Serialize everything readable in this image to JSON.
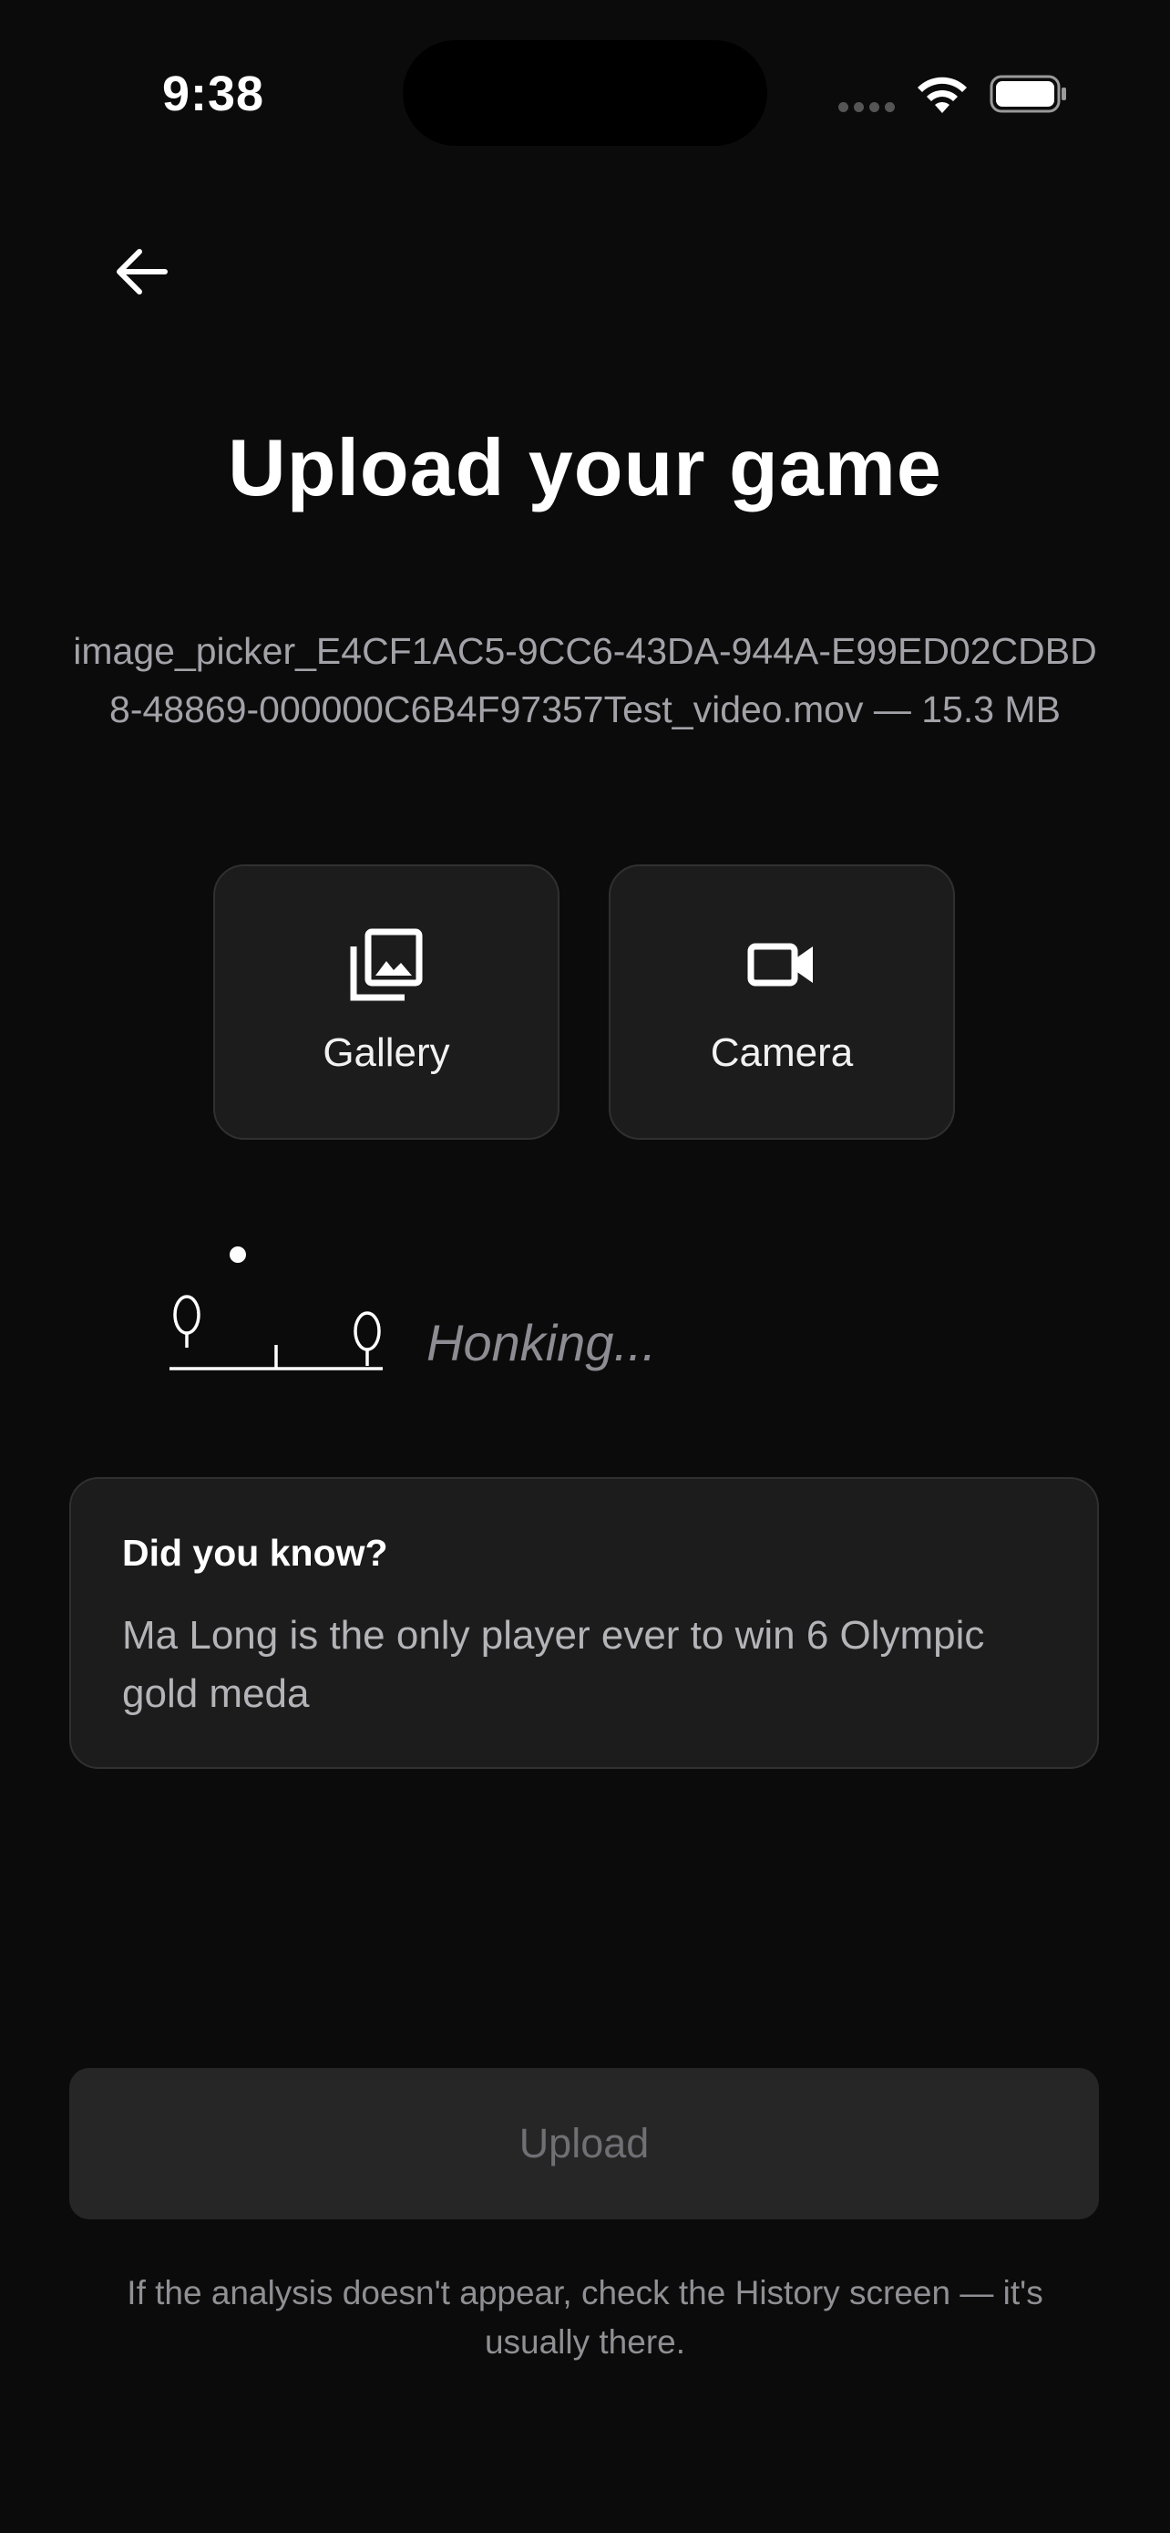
{
  "status_bar": {
    "time": "9:38"
  },
  "header": {
    "back_icon": "arrow-left-icon",
    "title": "Upload your game"
  },
  "file": {
    "info": "image_picker_E4CF1AC5-9CC6-43DA-944A-E99ED02CDBD8-48869-000000C6B4F97357Test_video.mov — 15.3 MB"
  },
  "sources": [
    {
      "label": "Gallery",
      "icon": "photo-library-icon"
    },
    {
      "label": "Camera",
      "icon": "videocam-icon"
    }
  ],
  "loader": {
    "text": "Honking..."
  },
  "fact": {
    "title": "Did you know?",
    "body": "Ma Long is the only player ever to win 6 Olympic gold meda"
  },
  "actions": {
    "upload_label": "Upload"
  },
  "footer": {
    "note": "If the analysis doesn't appear, check the History screen — it's usually there."
  },
  "colors": {
    "background": "#0b0b0b",
    "card": "#1c1c1c",
    "card_border": "#303030",
    "disabled_button": "#262626",
    "muted_text": "#a2a2a8"
  }
}
